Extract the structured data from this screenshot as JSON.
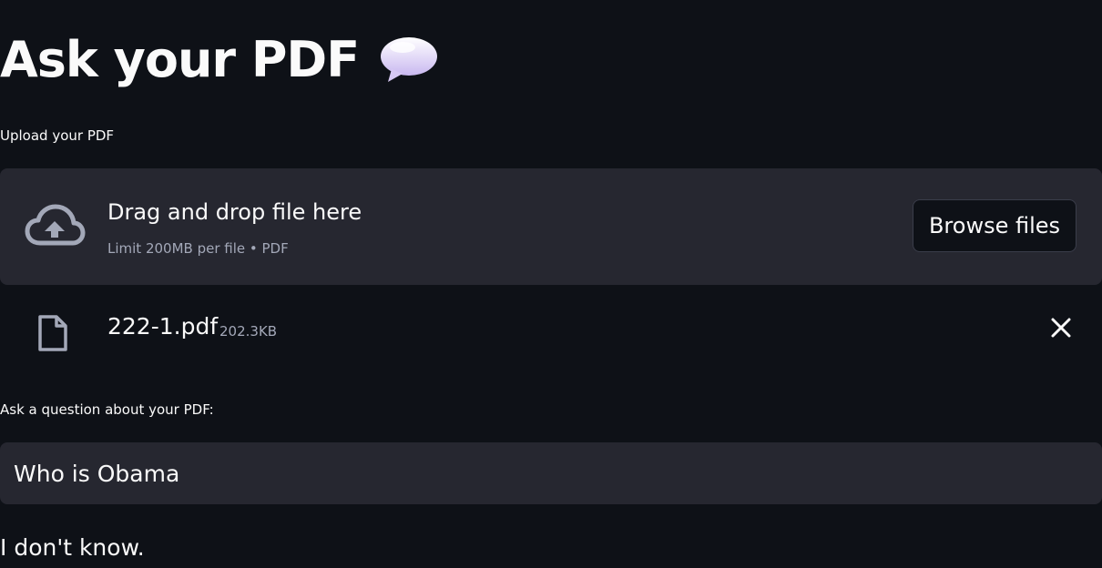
{
  "header": {
    "title": "Ask your PDF",
    "emoji_icon": "speech-balloon-icon"
  },
  "uploader": {
    "label": "Upload your PDF",
    "drop_title": "Drag and drop file here",
    "drop_subtitle": "Limit 200MB per file • PDF",
    "browse_label": "Browse files",
    "icon": "cloud-upload-icon"
  },
  "uploaded_file": {
    "name": "222-1.pdf",
    "size": "202.3KB",
    "icon": "file-icon",
    "remove_icon": "close-icon"
  },
  "question": {
    "label": "Ask a question about your PDF:",
    "value": "Who is Obama"
  },
  "answer": {
    "text": "I don't know."
  },
  "colors": {
    "background": "#0e1117",
    "panel": "#262730",
    "text": "#fafafa",
    "muted": "#a3a8b8"
  }
}
